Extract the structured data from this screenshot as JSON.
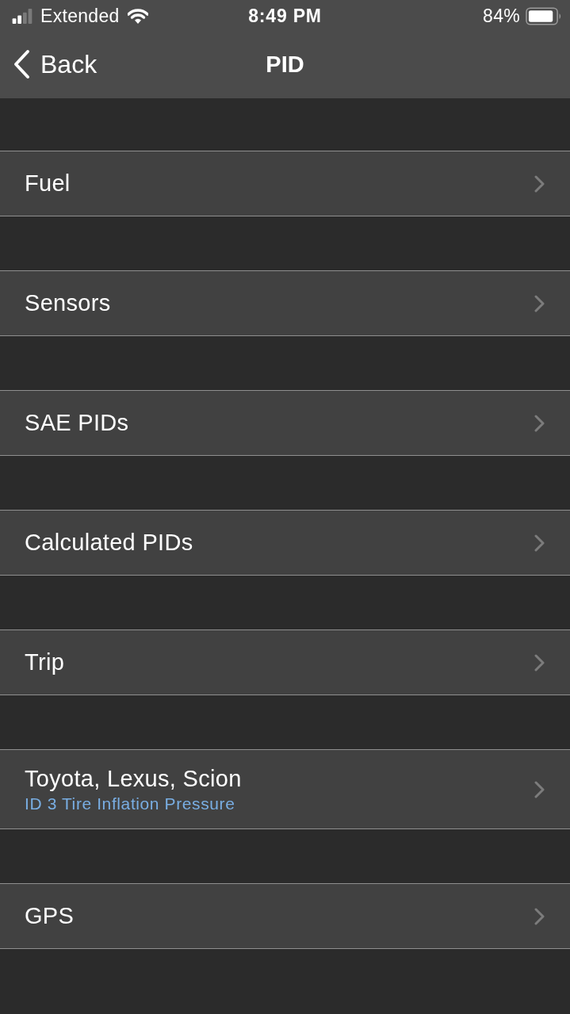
{
  "status_bar": {
    "carrier": "Extended",
    "time": "8:49 PM",
    "battery": "84%"
  },
  "nav_bar": {
    "back": "Back",
    "title": "PID"
  },
  "rows": [
    {
      "title": "Fuel"
    },
    {
      "title": "Sensors"
    },
    {
      "title": "SAE PIDs"
    },
    {
      "title": "Calculated PIDs"
    },
    {
      "title": "Trip"
    },
    {
      "title": "Toyota, Lexus, Scion",
      "subtitle": "ID 3 Tire Inflation Pressure"
    },
    {
      "title": "GPS"
    }
  ]
}
